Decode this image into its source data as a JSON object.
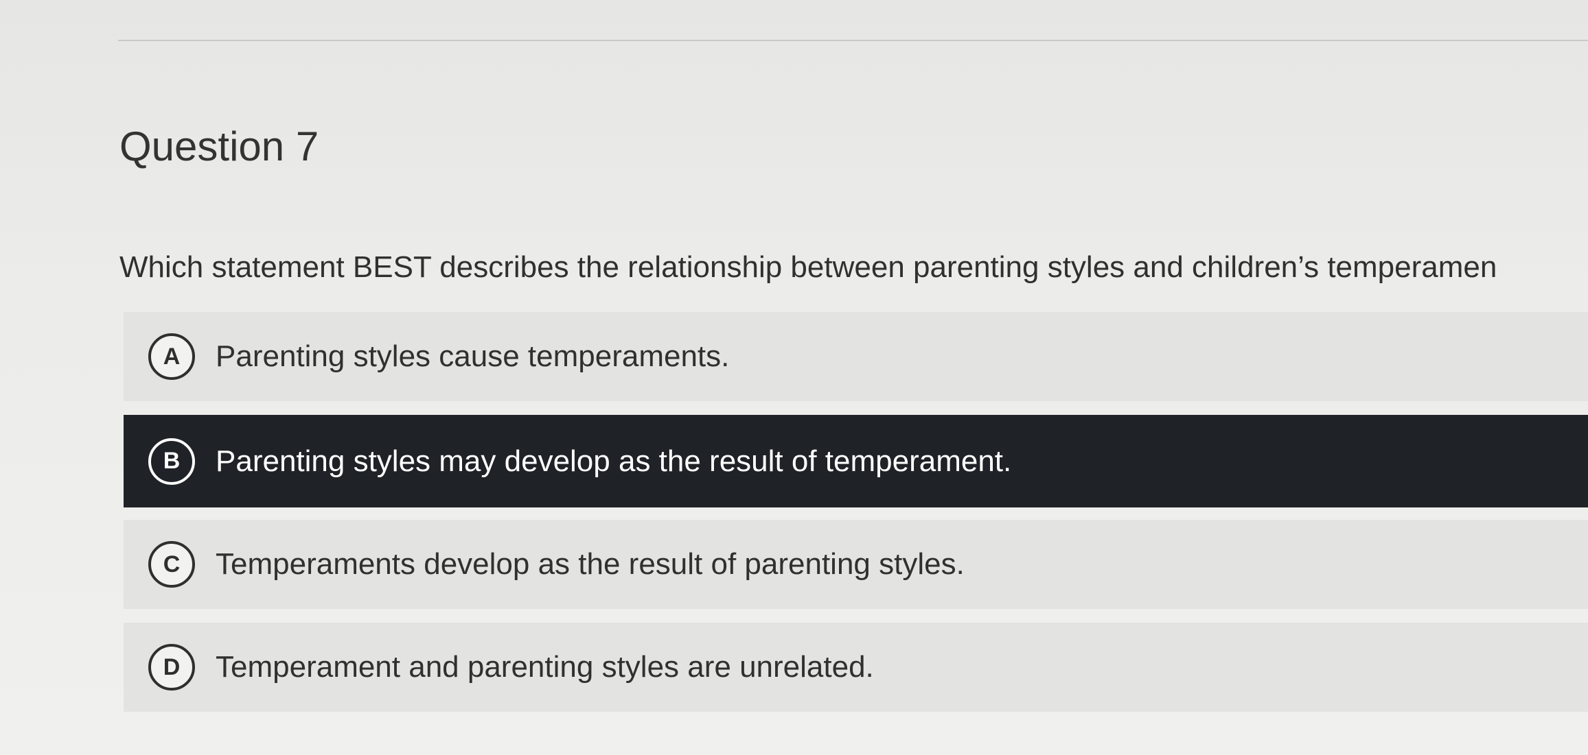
{
  "question": {
    "title": "Question 7",
    "prompt": "Which statement BEST describes the relationship between parenting styles and children’s temperamen"
  },
  "options": [
    {
      "letter": "A",
      "text": "Parenting styles cause temperaments.",
      "selected": false
    },
    {
      "letter": "B",
      "text": "Parenting styles may develop as the result of temperament.",
      "selected": true
    },
    {
      "letter": "C",
      "text": "Temperaments develop as the result of parenting styles.",
      "selected": false
    },
    {
      "letter": "D",
      "text": "Temperament and parenting styles are unrelated.",
      "selected": false
    }
  ],
  "colors": {
    "selected_background": "#1f2226",
    "option_background": "#e3e3e1",
    "page_background": "#ececea"
  }
}
